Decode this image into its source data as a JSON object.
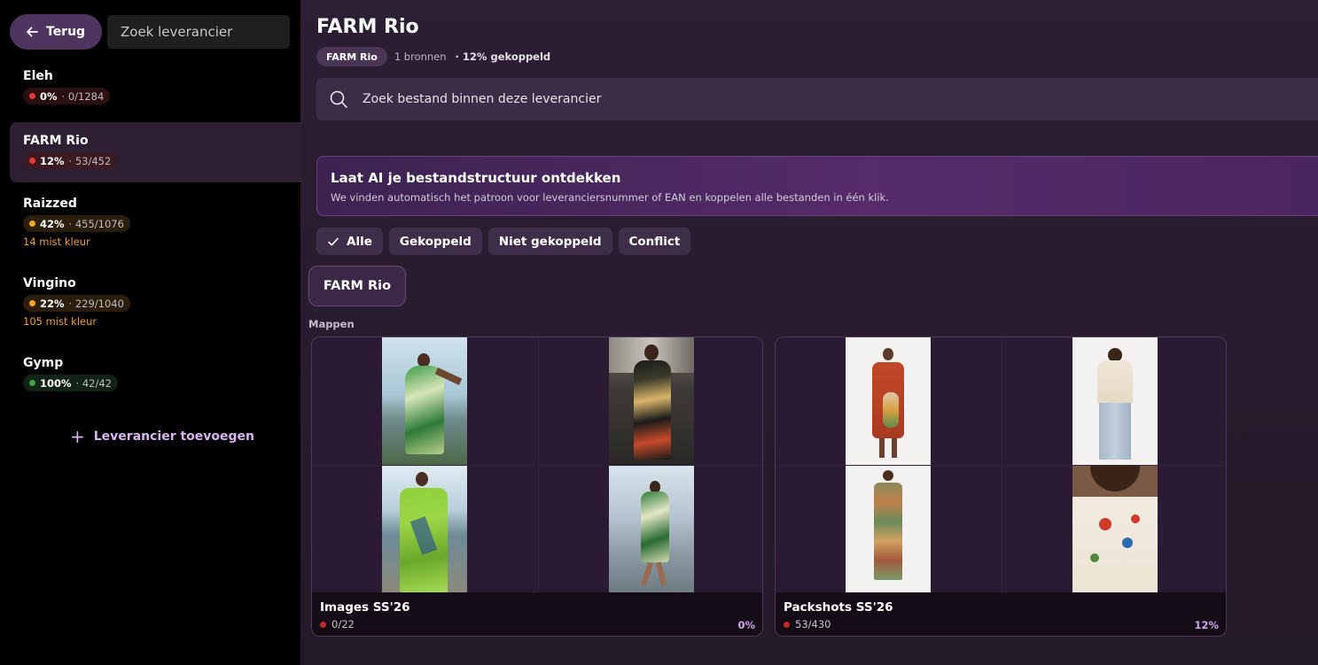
{
  "sidebar": {
    "back_label": "Terug",
    "search_placeholder": "Zoek leverancier",
    "suppliers": [
      {
        "name": "Eleh",
        "pct": "0%",
        "count": "· 0/1284",
        "status": "red",
        "missing": ""
      },
      {
        "name": "FARM Rio",
        "pct": "12%",
        "count": "· 53/452",
        "status": "red",
        "missing": ""
      },
      {
        "name": "Raizzed",
        "pct": "42%",
        "count": "· 455/1076",
        "status": "orange",
        "missing": "14 mist kleur"
      },
      {
        "name": "Vingino",
        "pct": "22%",
        "count": "· 229/1040",
        "status": "orange",
        "missing": "105 mist kleur"
      },
      {
        "name": "Gymp",
        "pct": "100%",
        "count": "· 42/42",
        "status": "green",
        "missing": ""
      }
    ],
    "add_label": "Leverancier toevoegen"
  },
  "main": {
    "title": "FARM Rio",
    "chip": "FARM Rio",
    "sources": "1 bronnen",
    "linked": "· 12% gekoppeld",
    "file_search_placeholder": "Zoek bestand binnen deze leverancier",
    "ai_banner": {
      "title": "Laat AI je bestandstructuur ontdekken",
      "subtitle": "We vinden automatisch het patroon voor leveranciersnummer of EAN en koppelen alle bestanden in één klik."
    },
    "filters": [
      "Alle",
      "Gekoppeld",
      "Niet gekoppeld",
      "Conflict"
    ],
    "active_filter": "Alle",
    "folder_chip": "FARM Rio",
    "section_label": "Mappen",
    "folders": [
      {
        "name": "Images SS'26",
        "count": "0/22",
        "pct": "0%"
      },
      {
        "name": "Packshots SS'26",
        "count": "53/430",
        "pct": "12%"
      }
    ]
  },
  "colors": {
    "accent": "#d8b4f0",
    "status_red": "#e53935",
    "status_orange": "#f5a623",
    "status_green": "#43a047"
  }
}
